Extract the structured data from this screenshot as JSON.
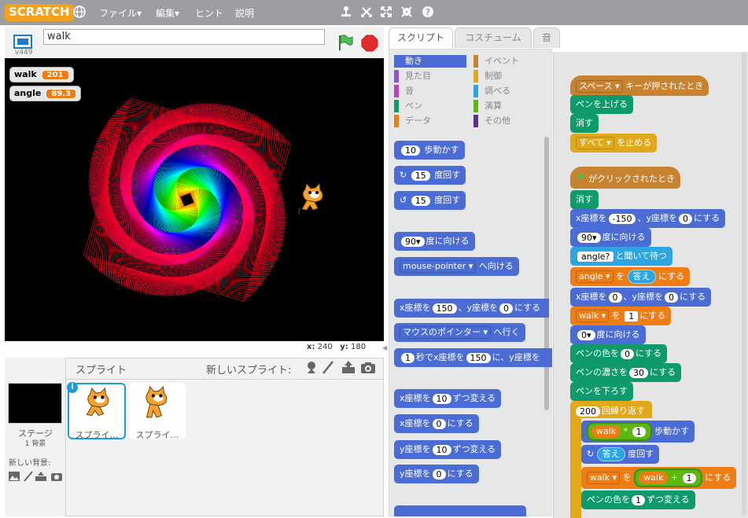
{
  "menubar": {
    "logo": "SCRATCH",
    "file": "ファイル▾",
    "edit": "編集▾",
    "tips": "ヒント",
    "about": "説明"
  },
  "project": {
    "name": "walk",
    "version": "v449"
  },
  "stage": {
    "vars": [
      {
        "name": "walk",
        "value": "201"
      },
      {
        "name": "angle",
        "value": "89.3"
      }
    ],
    "x_label": "x:",
    "x": "240",
    "y_label": "y:",
    "y": "180"
  },
  "sprites": {
    "title": "スプライト",
    "new_sprite": "新しいスプライト:",
    "stage_label": "ステージ",
    "backdrops": "1 背景",
    "new_backdrop": "新しい背景:",
    "items": [
      "スプライ…",
      "スプライ…"
    ]
  },
  "tabs": [
    "スクリプト",
    "コスチューム",
    "音"
  ],
  "categories": [
    {
      "label": "動き",
      "color": "#4a6cd4"
    },
    {
      "label": "イベント",
      "color": "#c88330"
    },
    {
      "label": "見た目",
      "color": "#8a55d7"
    },
    {
      "label": "制御",
      "color": "#e1a91a"
    },
    {
      "label": "音",
      "color": "#bb42c3"
    },
    {
      "label": "調べる",
      "color": "#2ca5e2"
    },
    {
      "label": "ペン",
      "color": "#0e9a6c"
    },
    {
      "label": "演算",
      "color": "#5cb712"
    },
    {
      "label": "データ",
      "color": "#ee7d16"
    },
    {
      "label": "その他",
      "color": "#632d99"
    }
  ],
  "palette": {
    "move": {
      "n": "10",
      "t": "歩動かす"
    },
    "turn_r": {
      "n": "15",
      "t": "度回す"
    },
    "turn_l": {
      "n": "15",
      "t": "度回す"
    },
    "point_dir": {
      "n": "90▾",
      "t": "度に向ける"
    },
    "point_towards": {
      "d": "mouse-pointer ▾",
      "t": "へ向ける"
    },
    "goto_xy": {
      "a": "x座標を",
      "x": "150",
      "b": "、y座標を",
      "y": "0",
      "c": "にする"
    },
    "goto": {
      "d": "マウスのポインター ▾",
      "t": "へ行く"
    },
    "glide": {
      "n": "1",
      "a": "秒でx座標を",
      "x": "150",
      "b": "に、y座標を"
    },
    "change_x": {
      "a": "x座標を",
      "n": "10",
      "b": "ずつ変える"
    },
    "set_x": {
      "a": "x座標を",
      "n": "0",
      "b": "にする"
    },
    "change_y": {
      "a": "y座標を",
      "n": "10",
      "b": "ずつ変える"
    },
    "set_y": {
      "a": "y座標を",
      "n": "0",
      "b": "にする"
    }
  },
  "script1": {
    "hat_key": "スペース ▾",
    "hat_t": "キーが押されたとき",
    "pen_up": "ペンを上げる",
    "clear": "消す",
    "stop_d": "すべて ▾",
    "stop_t": "を止める"
  },
  "script2": {
    "hat_t": "がクリックされたとき",
    "clear": "消す",
    "goto_a": "x座標を",
    "goto_x": "-150",
    "goto_b": "、y座標を",
    "goto_y": "0",
    "goto_c": "にする",
    "dir_n": "90▾",
    "dir_t": "度に向ける",
    "ask_q": "angle?",
    "ask_t": "と聞いて待つ",
    "set_angle_v": "angle ▾",
    "set_angle_a": "を",
    "set_angle_r": "答え",
    "set_angle_b": "にする",
    "goto2_a": "x座標を",
    "goto2_x": "0",
    "goto2_b": "、y座標を",
    "goto2_y": "0",
    "goto2_c": "にする",
    "set_walk_v": "walk ▾",
    "set_walk_a": "を",
    "set_walk_n": "1",
    "set_walk_b": "にする",
    "dir2_n": "0▾",
    "dir2_t": "度に向ける",
    "pencolor_a": "ペンの色を",
    "pencolor_n": "0",
    "pencolor_b": "にする",
    "shade_a": "ペンの濃さを",
    "shade_n": "30",
    "shade_b": "にする",
    "pen_down": "ペンを下ろす",
    "repeat_n": "200",
    "repeat_t": "回繰り返す",
    "mv_var": "walk",
    "mv_op": "*",
    "mv_n": "1",
    "mv_t": "歩動かす",
    "turn_r": "答え",
    "turn_t": "度回す",
    "setw_v": "walk ▾",
    "setw_a": "を",
    "setw_var": "walk",
    "setw_op": "+",
    "setw_n": "1",
    "setw_b": "にする",
    "chg_a": "ペンの色を",
    "chg_n": "1",
    "chg_b": "ずつ変える"
  }
}
